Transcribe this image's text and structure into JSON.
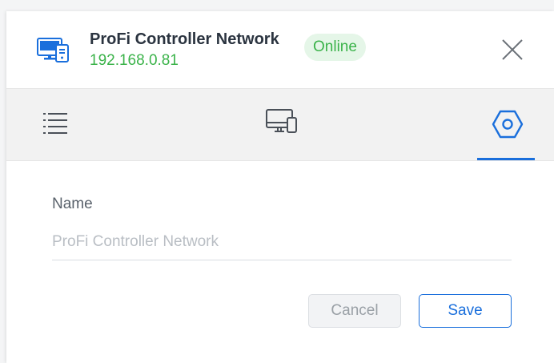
{
  "header": {
    "device_name": "ProFi Controller Network",
    "device_ip": "192.168.0.81",
    "status": "Online",
    "device_icon": "desktop-network-icon",
    "close_icon": "close-icon"
  },
  "tabs": [
    {
      "icon": "list-icon",
      "active": false
    },
    {
      "icon": "monitor-device-icon",
      "active": false
    },
    {
      "icon": "settings-hexagon-icon",
      "active": true
    }
  ],
  "form": {
    "name_label": "Name",
    "name_value": "",
    "name_placeholder": "ProFi Controller Network",
    "cancel_label": "Cancel",
    "save_label": "Save"
  },
  "colors": {
    "accent": "#1a6fdc",
    "online_text": "#3bb34a",
    "online_bg": "#e5f6e8"
  }
}
